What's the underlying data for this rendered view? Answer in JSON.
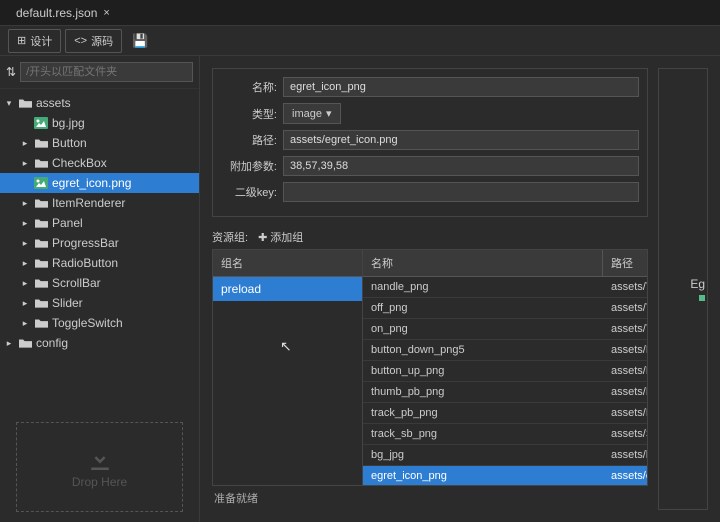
{
  "tab": {
    "title": "default.res.json"
  },
  "toolbar": {
    "design": "设计",
    "source": "源码"
  },
  "sidebar": {
    "filter_placeholder": "/开头以匹配文件夹",
    "tree": [
      {
        "label": "assets",
        "type": "folder",
        "level": 0,
        "expanded": true
      },
      {
        "label": "bg.jpg",
        "type": "image",
        "level": 1
      },
      {
        "label": "Button",
        "type": "folder",
        "level": 1,
        "collapsed": true
      },
      {
        "label": "CheckBox",
        "type": "folder",
        "level": 1,
        "collapsed": true
      },
      {
        "label": "egret_icon.png",
        "type": "image",
        "level": 1,
        "selected": true
      },
      {
        "label": "ItemRenderer",
        "type": "folder",
        "level": 1,
        "collapsed": true
      },
      {
        "label": "Panel",
        "type": "folder",
        "level": 1,
        "collapsed": true
      },
      {
        "label": "ProgressBar",
        "type": "folder",
        "level": 1,
        "collapsed": true
      },
      {
        "label": "RadioButton",
        "type": "folder",
        "level": 1,
        "collapsed": true
      },
      {
        "label": "ScrollBar",
        "type": "folder",
        "level": 1,
        "collapsed": true
      },
      {
        "label": "Slider",
        "type": "folder",
        "level": 1,
        "collapsed": true
      },
      {
        "label": "ToggleSwitch",
        "type": "folder",
        "level": 1,
        "collapsed": true
      },
      {
        "label": "config",
        "type": "folder",
        "level": 0,
        "collapsed": true
      }
    ],
    "dropzone_text": "Drop Here"
  },
  "properties": {
    "name_label": "名称:",
    "name_value": "egret_icon_png",
    "type_label": "类型:",
    "type_value": "image",
    "path_label": "路径:",
    "path_value": "assets/egret_icon.png",
    "extra_label": "附加参数:",
    "extra_value": "38,57,39,58",
    "secondkey_label": "二级key:",
    "secondkey_value": ""
  },
  "preview": {
    "label": "Eg"
  },
  "groups": {
    "section_label": "资源组:",
    "add_label": "添加组",
    "groupname_header": "组名",
    "name_header": "名称",
    "path_header": "路径",
    "group_list": [
      {
        "name": "preload",
        "selected": true
      }
    ],
    "rows": [
      {
        "name": "nandle_png",
        "path": "assets/ToggleSwitch"
      },
      {
        "name": "off_png",
        "path": "assets/ToggleSwitch"
      },
      {
        "name": "on_png",
        "path": "assets/ToggleSwitch"
      },
      {
        "name": "button_down_png5",
        "path": "assets/Button/butto"
      },
      {
        "name": "button_up_png",
        "path": "assets/Button/butto"
      },
      {
        "name": "thumb_pb_png",
        "path": "assets/ProgressBar/"
      },
      {
        "name": "track_pb_png",
        "path": "assets/ProgressBar/"
      },
      {
        "name": "track_sb_png",
        "path": "assets/ScrollBar/tra"
      },
      {
        "name": "bg_jpg",
        "path": "assets/bg.jpg"
      },
      {
        "name": "egret_icon_png",
        "path": "assets/egret_icon.pn",
        "selected": true
      }
    ]
  },
  "status": {
    "text": "准备就绪"
  }
}
